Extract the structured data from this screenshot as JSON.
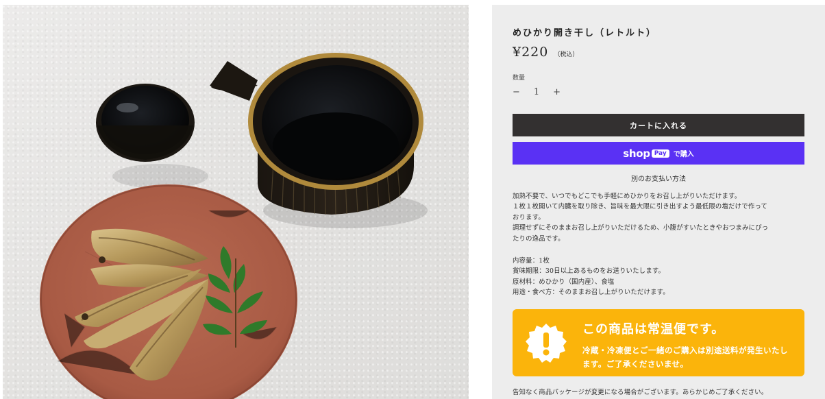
{
  "product": {
    "title": "めひかり開き干し（レトルト）",
    "price": "¥220",
    "tax_note": "（税込）"
  },
  "quantity": {
    "label": "数量",
    "minus": "−",
    "value": "1",
    "plus": "+"
  },
  "buttons": {
    "add_to_cart": "カートに入れる",
    "shop_pay_word": "shop",
    "shop_pay_badge": "Pay",
    "shop_pay_buy": "で購入",
    "other_payment": "別のお支払い方法"
  },
  "description": {
    "lines": [
      "加熱不要で、いつでもどこでも手軽にめひかりをお召し上がりいただけます。",
      "１枚１枚開いて内臓を取り除き、旨味を最大限に引き出すよう最低限の塩だけで作って",
      "おります。",
      "調理せずにそのままお召し上がりいただけるため、小腹がすいたときやおつまみにぴっ",
      "たりの逸品です。"
    ]
  },
  "specs": {
    "lines": [
      "内容量：1枚",
      "賞味期限：30日以上あるものをお送りいたします。",
      "原材料：めひかり（国内産）、食塩",
      "用途・食べ方：そのままお召し上がりいただけます。"
    ]
  },
  "notice": {
    "icon": "exclamation-badge-icon",
    "title": "この商品は常温便です。",
    "body": "冷蔵・冷凍便とご一緒のご購入は別途送料が発生いたします。ご了承くださいませ。",
    "color": "#fbb40b"
  },
  "footnote": "告知なく商品パッケージが変更になる場合がございます。あらかじめご了承ください。",
  "colors": {
    "cart_button": "#333030",
    "shop_pay": "#5a31f4",
    "panel_bg": "#ededed"
  }
}
